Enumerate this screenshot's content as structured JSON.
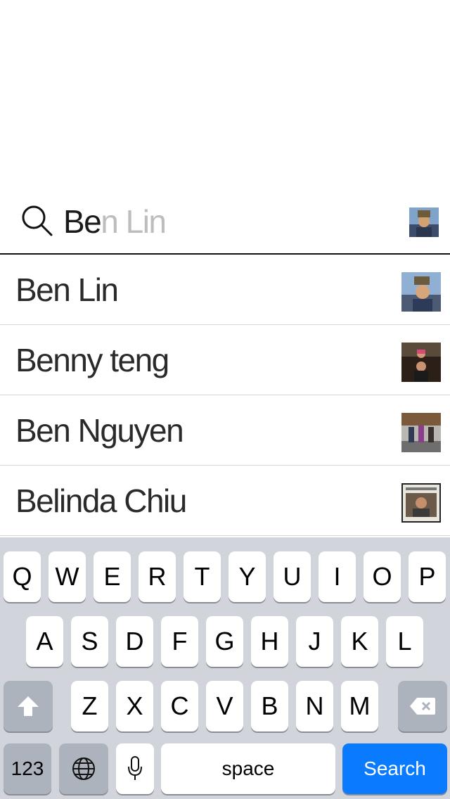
{
  "search": {
    "typed_text": "Be",
    "suggestion_text": "n Lin",
    "avatar": "user-avatar-photo"
  },
  "results": [
    {
      "name": "Ben Lin",
      "thumb": "photo-ben-lin"
    },
    {
      "name": "Benny teng",
      "thumb": "photo-benny-teng"
    },
    {
      "name": "Ben Nguyen",
      "thumb": "photo-ben-nguyen"
    },
    {
      "name": "Belinda Chiu",
      "thumb": "photo-belinda-chiu"
    }
  ],
  "keyboard": {
    "row1": [
      "Q",
      "W",
      "E",
      "R",
      "T",
      "Y",
      "U",
      "I",
      "O",
      "P"
    ],
    "row2": [
      "A",
      "S",
      "D",
      "F",
      "G",
      "H",
      "J",
      "K",
      "L"
    ],
    "row3": [
      "Z",
      "X",
      "C",
      "V",
      "B",
      "N",
      "M"
    ],
    "numbers_label": "123",
    "space_label": "space",
    "search_label": "Search",
    "icons": {
      "shift": "shift-icon",
      "backspace": "backspace-icon",
      "globe": "globe-icon",
      "mic": "microphone-icon"
    },
    "colors": {
      "background": "#d1d5db",
      "key": "#ffffff",
      "dark_key": "#adb3bc",
      "search_key": "#0a7aff"
    }
  }
}
